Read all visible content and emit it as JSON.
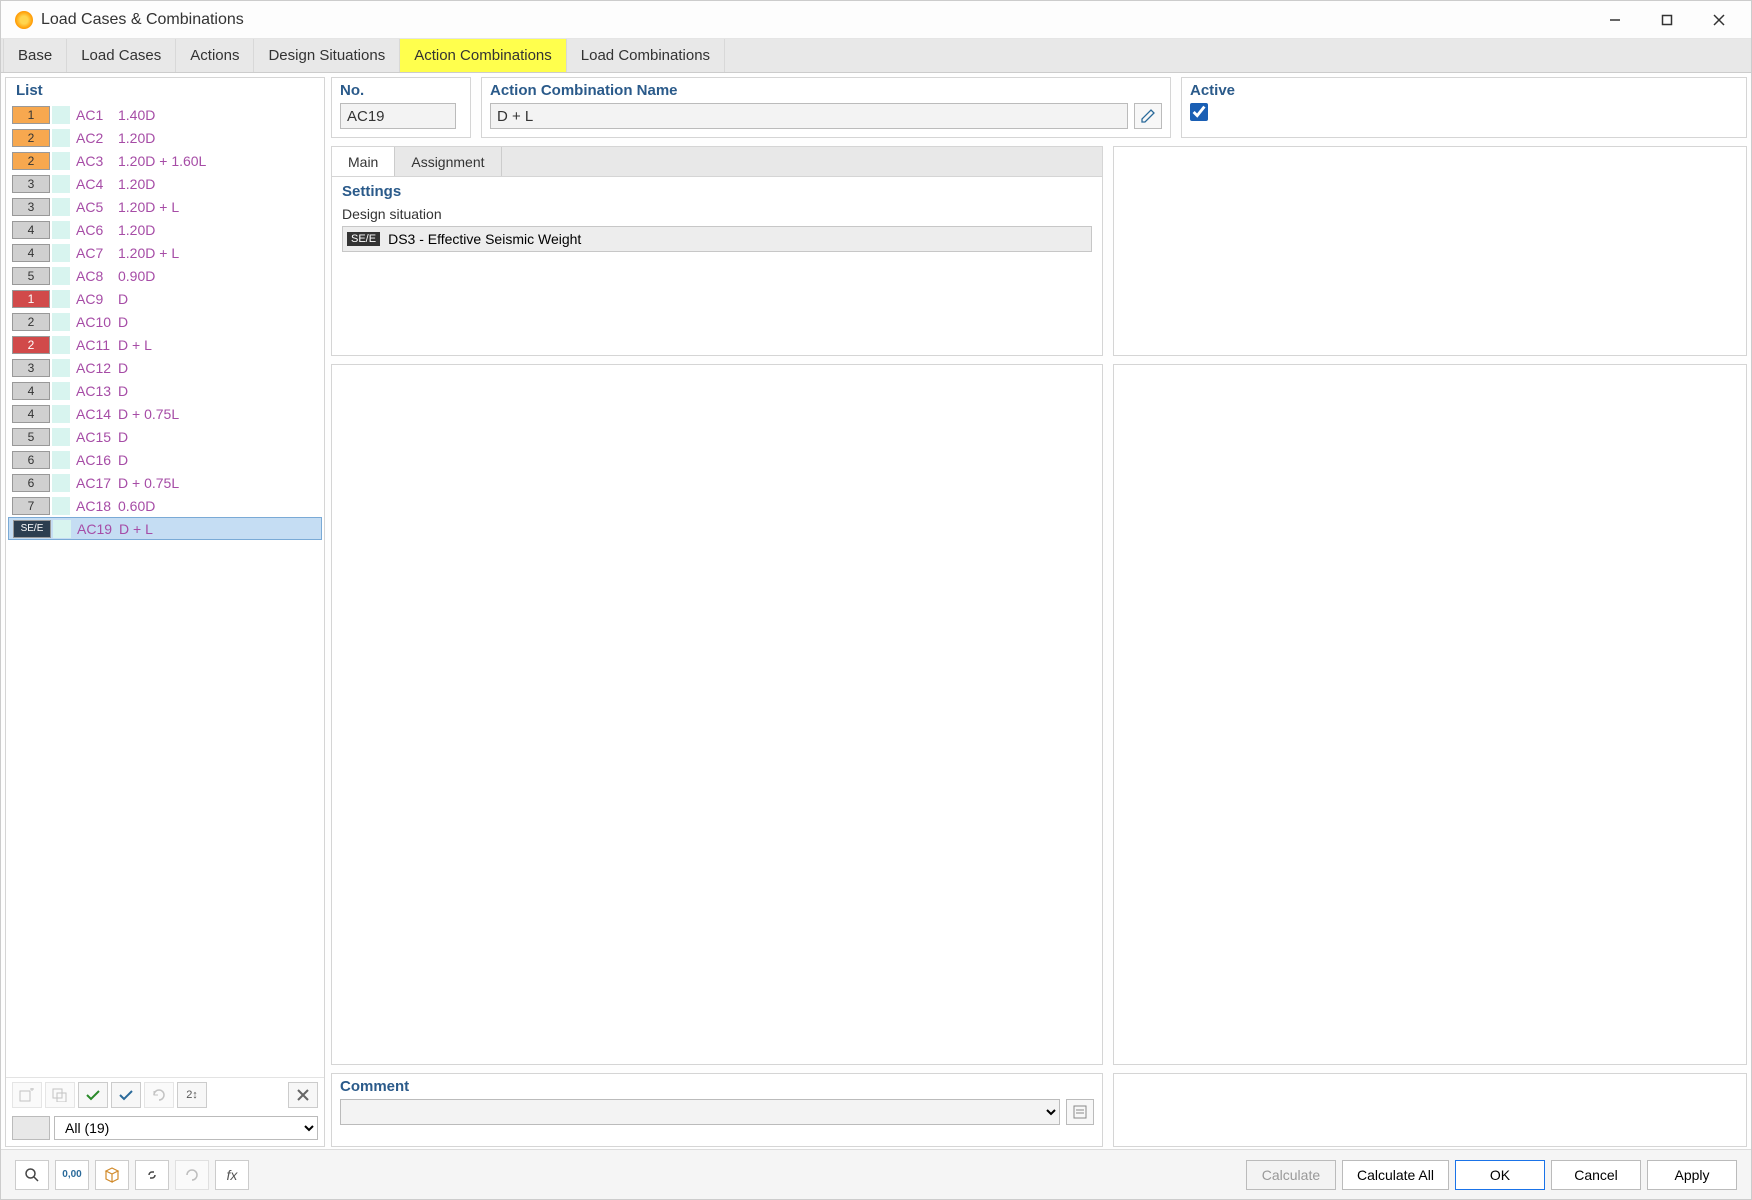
{
  "window": {
    "title": "Load Cases & Combinations"
  },
  "tabs": [
    "Base",
    "Load Cases",
    "Actions",
    "Design Situations",
    "Action Combinations",
    "Load Combinations"
  ],
  "active_tab": 4,
  "left": {
    "header": "List",
    "filter": "All (19)",
    "rows": [
      {
        "badge": "1",
        "color": "bc-orange",
        "id": "AC1",
        "name": "1.40D"
      },
      {
        "badge": "2",
        "color": "bc-orange",
        "id": "AC2",
        "name": "1.20D"
      },
      {
        "badge": "2",
        "color": "bc-orange",
        "id": "AC3",
        "name": "1.20D + 1.60L"
      },
      {
        "badge": "3",
        "color": "bc-gray",
        "id": "AC4",
        "name": "1.20D"
      },
      {
        "badge": "3",
        "color": "bc-gray",
        "id": "AC5",
        "name": "1.20D + L"
      },
      {
        "badge": "4",
        "color": "bc-gray",
        "id": "AC6",
        "name": "1.20D"
      },
      {
        "badge": "4",
        "color": "bc-gray",
        "id": "AC7",
        "name": "1.20D + L"
      },
      {
        "badge": "5",
        "color": "bc-gray",
        "id": "AC8",
        "name": "0.90D"
      },
      {
        "badge": "1",
        "color": "bc-red",
        "id": "AC9",
        "name": "D"
      },
      {
        "badge": "2",
        "color": "bc-gray",
        "id": "AC10",
        "name": "D"
      },
      {
        "badge": "2",
        "color": "bc-red",
        "id": "AC11",
        "name": "D + L"
      },
      {
        "badge": "3",
        "color": "bc-gray",
        "id": "AC12",
        "name": "D"
      },
      {
        "badge": "4",
        "color": "bc-gray",
        "id": "AC13",
        "name": "D"
      },
      {
        "badge": "4",
        "color": "bc-gray",
        "id": "AC14",
        "name": "D + 0.75L"
      },
      {
        "badge": "5",
        "color": "bc-gray",
        "id": "AC15",
        "name": "D"
      },
      {
        "badge": "6",
        "color": "bc-gray",
        "id": "AC16",
        "name": "D"
      },
      {
        "badge": "6",
        "color": "bc-gray",
        "id": "AC17",
        "name": "D + 0.75L"
      },
      {
        "badge": "7",
        "color": "bc-gray",
        "id": "AC18",
        "name": "0.60D"
      },
      {
        "badge": "SE/E",
        "color": "bc-dark",
        "id": "AC19",
        "name": "D + L",
        "selected": true
      }
    ]
  },
  "detail": {
    "no_label": "No.",
    "no_value": "AC19",
    "name_label": "Action Combination Name",
    "name_value": "D + L",
    "active_label": "Active",
    "active_value": true,
    "sub_tabs": [
      "Main",
      "Assignment"
    ],
    "active_sub_tab": 0,
    "settings_header": "Settings",
    "design_situation_label": "Design situation",
    "design_situation_badge": "SE/E",
    "design_situation_value": "DS3 - Effective Seismic Weight",
    "comment_label": "Comment",
    "comment_value": ""
  },
  "footer": {
    "calculate": "Calculate",
    "calculate_all": "Calculate All",
    "ok": "OK",
    "cancel": "Cancel",
    "apply": "Apply"
  }
}
